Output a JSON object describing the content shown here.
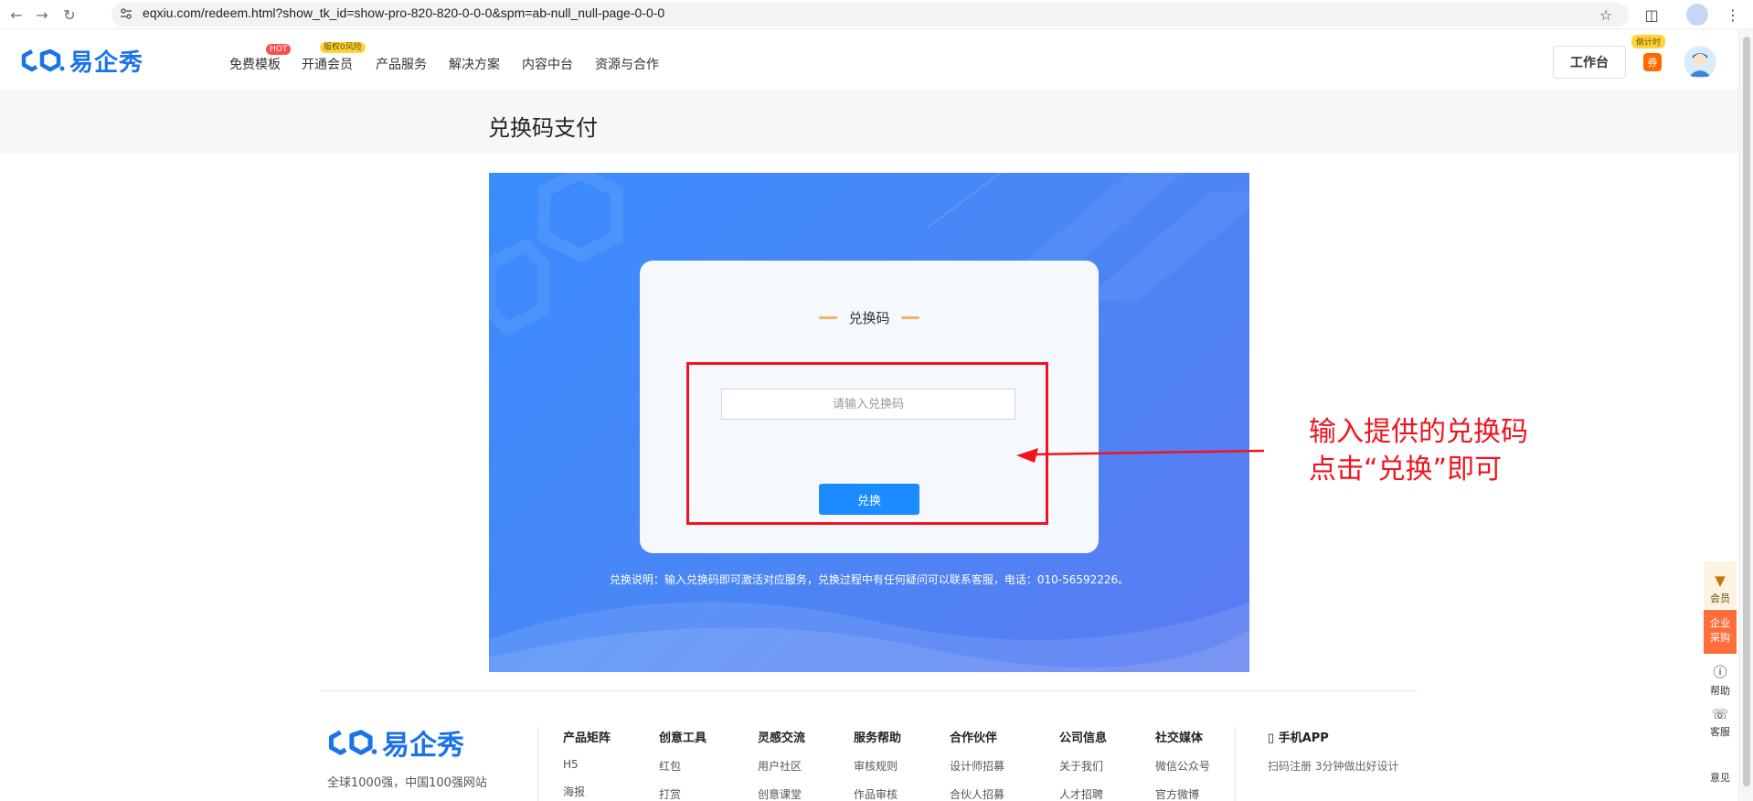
{
  "browser": {
    "url": "eqxiu.com/redeem.html?show_tk_id=show-pro-820-820-0-0-0&spm=ab-null_null-page-0-0-0"
  },
  "header": {
    "logo_text": "易企秀",
    "nav": [
      {
        "label": "免费模板",
        "badge": "HOT"
      },
      {
        "label": "开通会员",
        "badge": "版权0风险"
      },
      {
        "label": "产品服务",
        "badge": ""
      },
      {
        "label": "解决方案",
        "badge": ""
      },
      {
        "label": "内容中台",
        "badge": ""
      },
      {
        "label": "资源与合作",
        "badge": ""
      }
    ],
    "workbench_label": "工作台",
    "coupon_label": "券",
    "coupon_tag": "倒计时"
  },
  "page": {
    "title": "兑换码支付"
  },
  "redeem": {
    "card_title": "兑换码",
    "input_placeholder": "请输入兑换码",
    "button_label": "兑换",
    "note": "兑换说明：输入兑换码即可激活对应服务，兑换过程中有任何疑问可以联系客服，电话：010-56592226。"
  },
  "annotation": {
    "line1": "输入提供的兑换码",
    "line2": "点击“兑换”即可"
  },
  "float_bar": {
    "vip": "会员",
    "enterprise_line1": "企业",
    "enterprise_line2": "采购",
    "help": "帮助",
    "service": "客服",
    "feedback": "意见"
  },
  "footer": {
    "logo_text": "易企秀",
    "slogan": "全球1000强，中国100强网站",
    "columns": [
      {
        "title": "产品矩阵",
        "links": [
          "H5",
          "海报"
        ]
      },
      {
        "title": "创意工具",
        "links": [
          "红包",
          "打赏"
        ]
      },
      {
        "title": "灵感交流",
        "links": [
          "用户社区",
          "创意课堂"
        ]
      },
      {
        "title": "服务帮助",
        "links": [
          "审核规则",
          "作品审核"
        ]
      },
      {
        "title": "合作伙伴",
        "links": [
          "设计师招募",
          "合伙人招募"
        ]
      },
      {
        "title": "公司信息",
        "links": [
          "关于我们",
          "人才招聘"
        ]
      },
      {
        "title": "社交媒体",
        "links": [
          "微信公众号",
          "官方微博"
        ]
      }
    ],
    "app_title": "手机APP",
    "app_desc": "扫码注册 3分钟做出好设计"
  },
  "colors": {
    "brand": "#1a73e8",
    "button": "#1a8cff",
    "annotation": "#f0141e"
  }
}
